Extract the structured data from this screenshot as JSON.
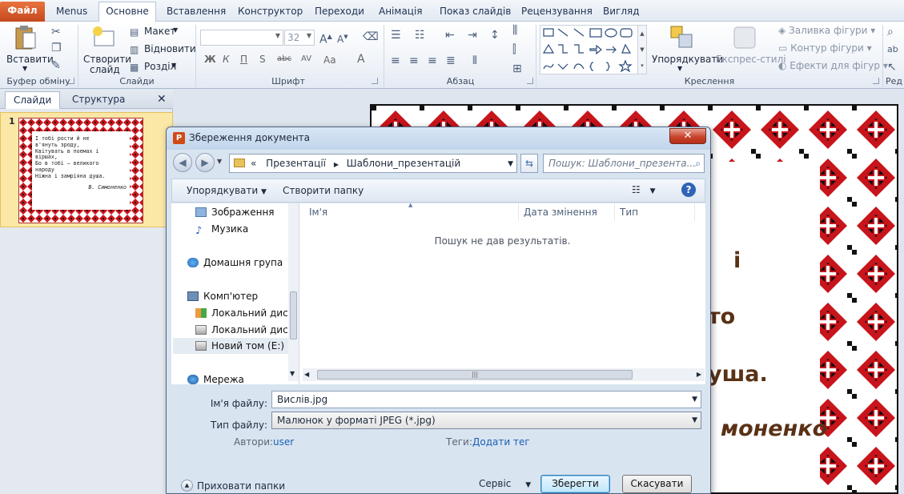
{
  "ribbon": {
    "tabs": [
      "Файл",
      "Menus",
      "Основне",
      "Вставлення",
      "Конструктор",
      "Переходи",
      "Анімація",
      "Показ слайдів",
      "Рецензування",
      "Вигляд"
    ],
    "active_tab": "Основне",
    "groups": {
      "clipboard": {
        "label": "Буфер обміну",
        "paste": "Вставити"
      },
      "slides": {
        "label": "Слайди",
        "new_slide_l1": "Створити",
        "new_slide_l2": "слайд",
        "layout": "Макет",
        "reset": "Відновити",
        "section": "Розділ"
      },
      "font": {
        "label": "Шрифт",
        "size": "32",
        "buttons": [
          "Ж",
          "К",
          "П",
          "S",
          "abc",
          "AV",
          "Aa",
          "A"
        ]
      },
      "paragraph": {
        "label": "Абзац"
      },
      "drawing": {
        "label": "Креслення",
        "arrange": "Упорядкувати",
        "quick_styles": "Експрес-стилі",
        "fill": "Заливка фігури",
        "outline": "Контур фігури",
        "effects": "Ефекти для фігур"
      },
      "editing": {
        "partial": "Ред"
      }
    }
  },
  "left_pane": {
    "tabs": [
      "Слайди",
      "Структура"
    ],
    "slide_number": "1",
    "thumb_lines": [
      "І тобі рости й не",
      "в'януть зроду,",
      "Квітувать в поемах і",
      "віршах,",
      "Бо в тобі – великого",
      "народу",
      "Ніжна і замріяна душа."
    ],
    "thumb_author": "В. Симоненко"
  },
  "slide_partial": [
    "і",
    "то",
    "уша.",
    "моненко"
  ],
  "dialog": {
    "title": "Збереження документа",
    "path": [
      "«",
      "Презентації",
      "Шаблони_презентацій"
    ],
    "search_placeholder": "Пошук: Шаблони_презента...",
    "toolbar": {
      "organize": "Упорядкувати",
      "new_folder": "Створити папку"
    },
    "nav_items": [
      "Зображення",
      "Музика",
      "Домашня група",
      "Комп'ютер",
      "Локальний диск",
      "Локальний диск",
      "Новий том (E:)",
      "Мережа"
    ],
    "columns": [
      "Ім'я",
      "Дата змінення",
      "Тип"
    ],
    "empty_msg": "Пошук не дав результатів.",
    "filename_label": "Ім'я файлу:",
    "filename_value": "Вислів.jpg",
    "filetype_label": "Тип файлу:",
    "filetype_value": "Малюнок у форматі JPEG (*.jpg)",
    "authors_label": "Автори:",
    "authors_value": "user",
    "tags_label": "Теги:",
    "tags_value": "Додати тег",
    "hide_folders": "Приховати папки",
    "service": "Сервіс",
    "save": "Зберегти",
    "cancel": "Скасувати"
  },
  "colors": {
    "accent_file_tab": "#d35a26",
    "ornament_red": "#c8141b",
    "ornament_dark": "#1a1a1a",
    "text_brown": "#5a3116",
    "link": "#1a5fb4"
  }
}
